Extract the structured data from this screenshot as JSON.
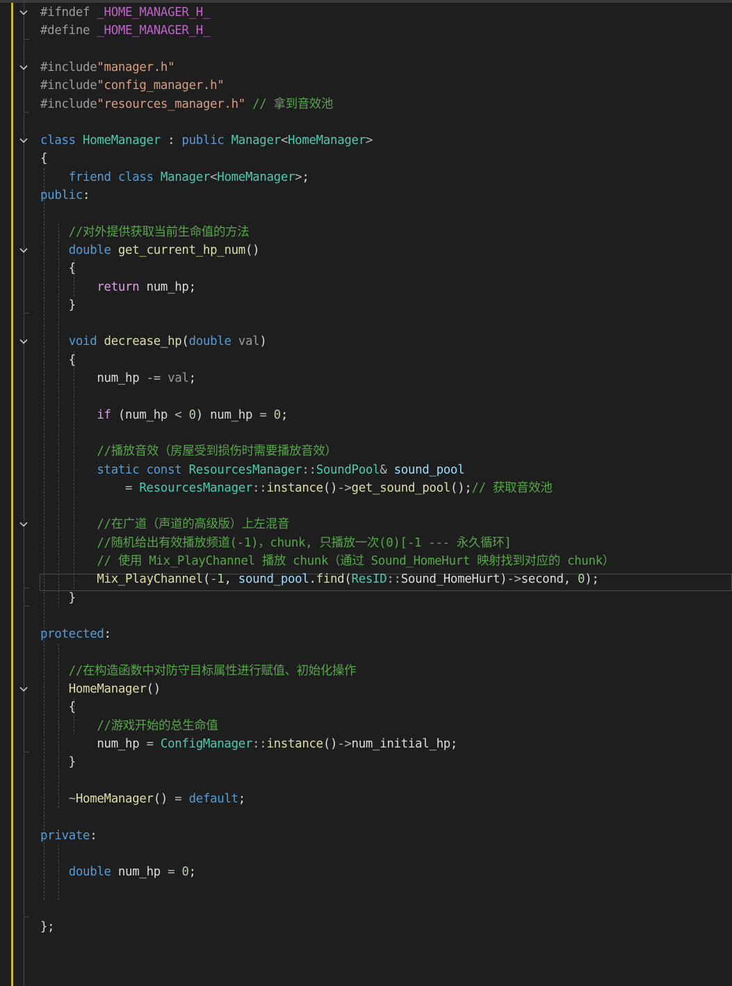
{
  "editor": {
    "accent_colors": {
      "keyword": "#569cd6",
      "control_keyword": "#d8a0df",
      "comment": "#57a64a",
      "type": "#4ec9b0",
      "function": "#dcdcaa",
      "variable": "#9cdcfe",
      "string": "#d69d85",
      "macro": "#bd63c5",
      "number": "#b5cea8",
      "change_bar": "#c7b73a",
      "background": "#1e1e1e"
    },
    "lines": [
      [
        [
          "pp",
          "#ifndef "
        ],
        [
          "mc",
          "_HOME_MANAGER_H_"
        ]
      ],
      [
        [
          "pp",
          "#define "
        ],
        [
          "mc",
          "_HOME_MANAGER_H_"
        ]
      ],
      [],
      [
        [
          "pp",
          "#include"
        ],
        [
          "str",
          "\"manager.h\""
        ]
      ],
      [
        [
          "pp",
          "#include"
        ],
        [
          "str",
          "\"config_manager.h\""
        ]
      ],
      [
        [
          "pp",
          "#include"
        ],
        [
          "str",
          "\"resources_manager.h\""
        ],
        [
          "tx",
          " "
        ],
        [
          "cm",
          "// 拿到音效池"
        ]
      ],
      [],
      [
        [
          "kw",
          "class "
        ],
        [
          "ty",
          "HomeManager"
        ],
        [
          "tx",
          " : "
        ],
        [
          "kw",
          "public "
        ],
        [
          "ty",
          "Manager"
        ],
        [
          "op",
          "<"
        ],
        [
          "ty",
          "HomeManager"
        ],
        [
          "op",
          ">"
        ]
      ],
      [
        [
          "tx",
          "{"
        ]
      ],
      [
        [
          "tx",
          "    "
        ],
        [
          "kw",
          "friend "
        ],
        [
          "kw",
          "class "
        ],
        [
          "ty",
          "Manager"
        ],
        [
          "op",
          "<"
        ],
        [
          "ty",
          "HomeManager"
        ],
        [
          "op",
          ">"
        ],
        [
          "tx",
          ";"
        ]
      ],
      [
        [
          "kw",
          "public"
        ],
        [
          "tx",
          ":"
        ]
      ],
      [],
      [
        [
          "tx",
          "    "
        ],
        [
          "cm",
          "//对外提供获取当前生命值的方法"
        ]
      ],
      [
        [
          "tx",
          "    "
        ],
        [
          "kw",
          "double "
        ],
        [
          "fn",
          "get_current_hp_num"
        ],
        [
          "tx",
          "()"
        ]
      ],
      [
        [
          "tx",
          "    {"
        ]
      ],
      [
        [
          "tx",
          "        "
        ],
        [
          "kw2",
          "return "
        ],
        [
          "tx",
          "num_hp;"
        ]
      ],
      [
        [
          "tx",
          "    }"
        ]
      ],
      [],
      [
        [
          "tx",
          "    "
        ],
        [
          "kw",
          "void "
        ],
        [
          "fn",
          "decrease_hp"
        ],
        [
          "tx",
          "("
        ],
        [
          "kw",
          "double "
        ],
        [
          "pm",
          "val"
        ],
        [
          "tx",
          ")"
        ]
      ],
      [
        [
          "tx",
          "    {"
        ]
      ],
      [
        [
          "tx",
          "        num_hp "
        ],
        [
          "op",
          "-="
        ],
        [
          "tx",
          " "
        ],
        [
          "pm",
          "val"
        ],
        [
          "tx",
          ";"
        ]
      ],
      [],
      [
        [
          "tx",
          "        "
        ],
        [
          "kw2",
          "if "
        ],
        [
          "tx",
          "(num_hp "
        ],
        [
          "op",
          "<"
        ],
        [
          "tx",
          " "
        ],
        [
          "nm",
          "0"
        ],
        [
          "tx",
          ") num_hp "
        ],
        [
          "op",
          "="
        ],
        [
          "tx",
          " "
        ],
        [
          "nm",
          "0"
        ],
        [
          "tx",
          ";"
        ]
      ],
      [],
      [
        [
          "tx",
          "        "
        ],
        [
          "cm",
          "//播放音效（房屋受到损伤时需要播放音效）"
        ]
      ],
      [
        [
          "tx",
          "        "
        ],
        [
          "kw",
          "static "
        ],
        [
          "kw",
          "const "
        ],
        [
          "ty",
          "ResourcesManager"
        ],
        [
          "op",
          "::"
        ],
        [
          "ty",
          "SoundPool"
        ],
        [
          "op",
          "&"
        ],
        [
          "tx",
          " "
        ],
        [
          "vr",
          "sound_pool"
        ]
      ],
      [
        [
          "tx",
          "            "
        ],
        [
          "op",
          "= "
        ],
        [
          "ty",
          "ResourcesManager"
        ],
        [
          "op",
          "::"
        ],
        [
          "fn",
          "instance"
        ],
        [
          "tx",
          "()"
        ],
        [
          "op",
          "->"
        ],
        [
          "fn",
          "get_sound_pool"
        ],
        [
          "tx",
          "();"
        ],
        [
          "cm",
          "// 获取音效池"
        ]
      ],
      [],
      [
        [
          "tx",
          "        "
        ],
        [
          "cm",
          "//在广道（声道的高级版）上左混音"
        ]
      ],
      [
        [
          "tx",
          "        "
        ],
        [
          "cm",
          "//随机给出有效播放频道(-1)，chunk, 只播放一次(0)[-1 --- 永久循环]"
        ]
      ],
      [
        [
          "tx",
          "        "
        ],
        [
          "cm",
          "// 使用 Mix_PlayChannel 播放 chunk（通过 Sound_HomeHurt 映射找到对应的 chunk）"
        ]
      ],
      [
        [
          "tx",
          "        "
        ],
        [
          "fn",
          "Mix_PlayChannel"
        ],
        [
          "tx",
          "("
        ],
        [
          "op",
          "-"
        ],
        [
          "nm",
          "1"
        ],
        [
          "tx",
          ", "
        ],
        [
          "vr",
          "sound_pool"
        ],
        [
          "tx",
          "."
        ],
        [
          "fn",
          "find"
        ],
        [
          "tx",
          "("
        ],
        [
          "ty",
          "ResID"
        ],
        [
          "op",
          "::"
        ],
        [
          "tx",
          "Sound_HomeHurt)"
        ],
        [
          "op",
          "->"
        ],
        [
          "tx",
          "second, "
        ],
        [
          "nm",
          "0"
        ],
        [
          "tx",
          ");"
        ]
      ],
      [
        [
          "tx",
          "    }"
        ]
      ],
      [],
      [
        [
          "kw",
          "protected"
        ],
        [
          "tx",
          ":"
        ]
      ],
      [],
      [
        [
          "tx",
          "    "
        ],
        [
          "cm",
          "//在构造函数中对防守目标属性进行赋值、初始化操作"
        ]
      ],
      [
        [
          "tx",
          "    "
        ],
        [
          "fn",
          "HomeManager"
        ],
        [
          "tx",
          "()"
        ]
      ],
      [
        [
          "tx",
          "    {"
        ]
      ],
      [
        [
          "tx",
          "        "
        ],
        [
          "cm",
          "//游戏开始的总生命值"
        ]
      ],
      [
        [
          "tx",
          "        num_hp "
        ],
        [
          "op",
          "="
        ],
        [
          "tx",
          " "
        ],
        [
          "ty",
          "ConfigManager"
        ],
        [
          "op",
          "::"
        ],
        [
          "fn",
          "instance"
        ],
        [
          "tx",
          "()"
        ],
        [
          "op",
          "->"
        ],
        [
          "tx",
          "num_initial_hp;"
        ]
      ],
      [
        [
          "tx",
          "    }"
        ]
      ],
      [],
      [
        [
          "tx",
          "    "
        ],
        [
          "op",
          "~"
        ],
        [
          "fn",
          "HomeManager"
        ],
        [
          "tx",
          "() "
        ],
        [
          "op",
          "="
        ],
        [
          "tx",
          " "
        ],
        [
          "kw",
          "default"
        ],
        [
          "tx",
          ";"
        ]
      ],
      [],
      [
        [
          "kw",
          "private"
        ],
        [
          "tx",
          ":"
        ]
      ],
      [],
      [
        [
          "tx",
          "    "
        ],
        [
          "kw",
          "double "
        ],
        [
          "tx",
          "num_hp "
        ],
        [
          "op",
          "="
        ],
        [
          "tx",
          " "
        ],
        [
          "nm",
          "0"
        ],
        [
          "tx",
          ";"
        ]
      ],
      [],
      [],
      [
        [
          "tx",
          "};"
        ]
      ]
    ],
    "fold_lines": [
      0,
      3,
      7,
      13,
      18,
      28,
      37
    ],
    "current_line": 31
  }
}
